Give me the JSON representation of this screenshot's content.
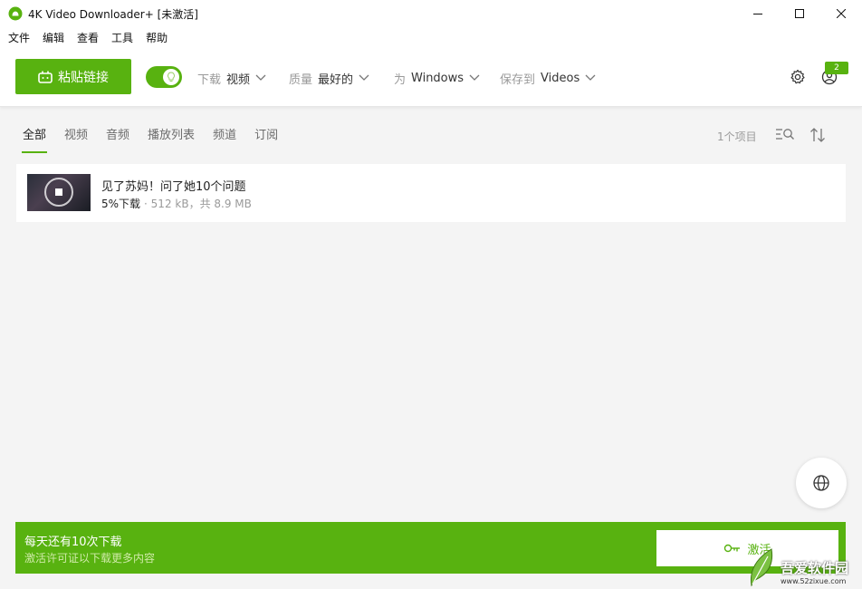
{
  "window": {
    "title": "4K Video Downloader+ [未激活]",
    "accent_color": "#58b210"
  },
  "menu": {
    "items": [
      "文件",
      "编辑",
      "查看",
      "工具",
      "帮助"
    ]
  },
  "toolbar": {
    "paste_label": "粘贴链接",
    "smart_mode_on": true,
    "download_label": "下载",
    "download_value": "视频",
    "quality_label": "质量",
    "quality_value": "最好的",
    "for_label": "为",
    "for_value": "Windows",
    "save_label": "保存到",
    "save_value": "Videos",
    "account_badge": "2",
    "icons": [
      "settings-gear-icon",
      "account-icon"
    ]
  },
  "tabs": {
    "items": [
      "全部",
      "视频",
      "音频",
      "播放列表",
      "频道",
      "订阅"
    ],
    "active_index": 0
  },
  "list": {
    "count_label": "1个项目",
    "items": [
      {
        "title": "见了苏妈！问了她10个问题",
        "progress_label": "5%下载",
        "meta": "· 512 kB，共 8.9 MB",
        "progress_percent": 5
      }
    ]
  },
  "promo": {
    "title": "每天还有10次下载",
    "subtitle": "激活许可证以下载更多内容",
    "activate_label": "激活"
  },
  "watermark": {
    "text": "吾爱软件园",
    "url": "www.52zixue.com"
  }
}
